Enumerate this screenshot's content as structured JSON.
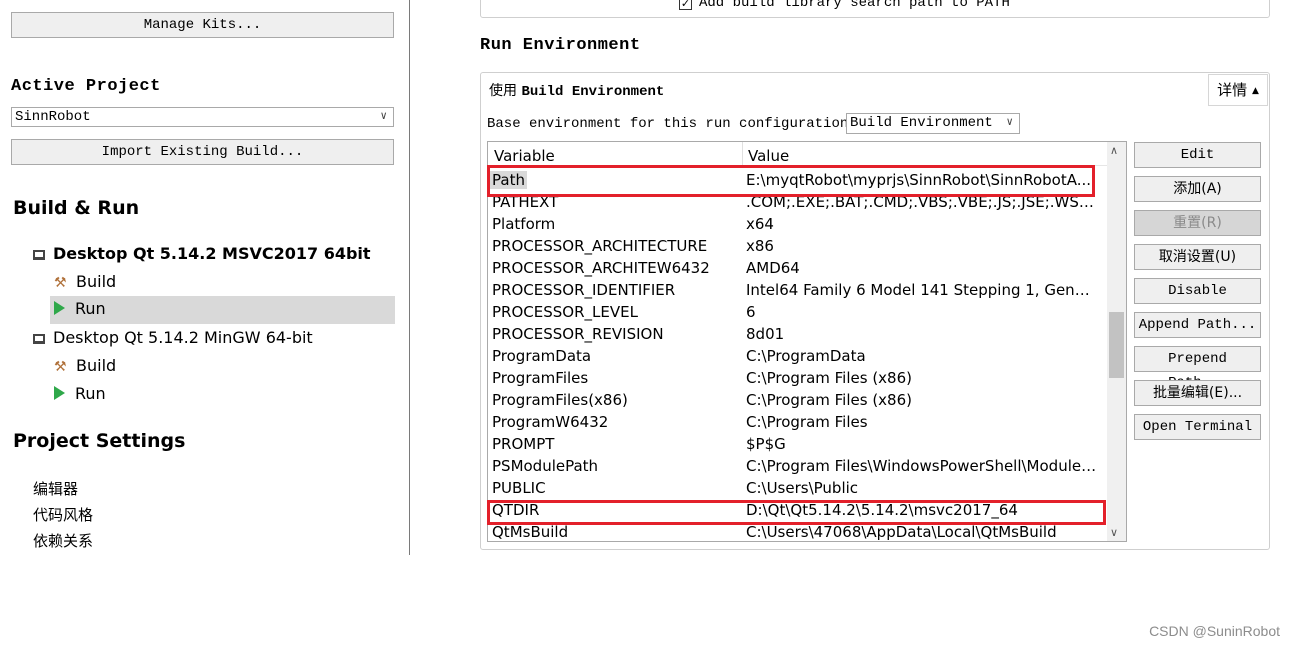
{
  "sidebar": {
    "manage_kits_label": "Manage Kits...",
    "active_project_title": "Active Project",
    "project_selected": "SinnRobot",
    "import_build_label": "Import Existing Build...",
    "build_run_title": "Build & Run",
    "kits": [
      {
        "name": "Desktop Qt 5.14.2 MSVC2017 64bit",
        "build_label": "Build",
        "run_label": "Run"
      },
      {
        "name": "Desktop Qt 5.14.2 MinGW 64-bit",
        "build_label": "Build",
        "run_label": "Run"
      }
    ],
    "project_settings_title": "Project Settings",
    "settings_items": [
      "编辑器",
      "代码风格",
      "依赖关系"
    ]
  },
  "main": {
    "add_library_path_label": "Add build library search path to PATH",
    "run_env_title": "Run Environment",
    "env_group_title_prefix": "使用 ",
    "env_group_title_bold": "Build Environment",
    "details_label": "详情",
    "base_env_label": "Base environment for this run configuration:",
    "base_env_value": "Build Environment",
    "table": {
      "headers": {
        "variable": "Variable",
        "value": "Value"
      },
      "rows": [
        {
          "var": "Path",
          "val": "E:\\myqtRobot\\myprjs\\SinnRobot\\SinnRobotA..."
        },
        {
          "var": "PATHEXT",
          "val": ".COM;.EXE;.BAT;.CMD;.VBS;.VBE;.JS;.JSE;.WSF;..."
        },
        {
          "var": "Platform",
          "val": "x64"
        },
        {
          "var": "PROCESSOR_ARCHITECTURE",
          "val": "x86"
        },
        {
          "var": "PROCESSOR_ARCHITEW6432",
          "val": "AMD64"
        },
        {
          "var": "PROCESSOR_IDENTIFIER",
          "val": "Intel64 Family 6 Model 141 Stepping 1, Genuin..."
        },
        {
          "var": "PROCESSOR_LEVEL",
          "val": "6"
        },
        {
          "var": "PROCESSOR_REVISION",
          "val": "8d01"
        },
        {
          "var": "ProgramData",
          "val": "C:\\ProgramData"
        },
        {
          "var": "ProgramFiles",
          "val": "C:\\Program Files (x86)"
        },
        {
          "var": "ProgramFiles(x86)",
          "val": "C:\\Program Files (x86)"
        },
        {
          "var": "ProgramW6432",
          "val": "C:\\Program Files"
        },
        {
          "var": "PROMPT",
          "val": "$P$G"
        },
        {
          "var": "PSModulePath",
          "val": "C:\\Program Files\\WindowsPowerShell\\Modules..."
        },
        {
          "var": "PUBLIC",
          "val": "C:\\Users\\Public"
        },
        {
          "var": "QTDIR",
          "val": "D:\\Qt\\Qt5.14.2\\5.14.2\\msvc2017_64"
        },
        {
          "var": "QtMsBuild",
          "val": "C:\\Users\\47068\\AppData\\Local\\QtMsBuild"
        }
      ]
    },
    "buttons": [
      "Edit",
      "添加(A)",
      "重置(R)",
      "取消设置(U)",
      "Disable",
      "Append Path...",
      "Prepend Path...",
      "批量编辑(E)...",
      "Open Terminal"
    ]
  },
  "watermark": "CSDN @SuninRobot",
  "colors": {
    "highlight": "#e3202a",
    "run_selected_bg": "#d9d9d9",
    "play_icon": "#2fa84a"
  }
}
